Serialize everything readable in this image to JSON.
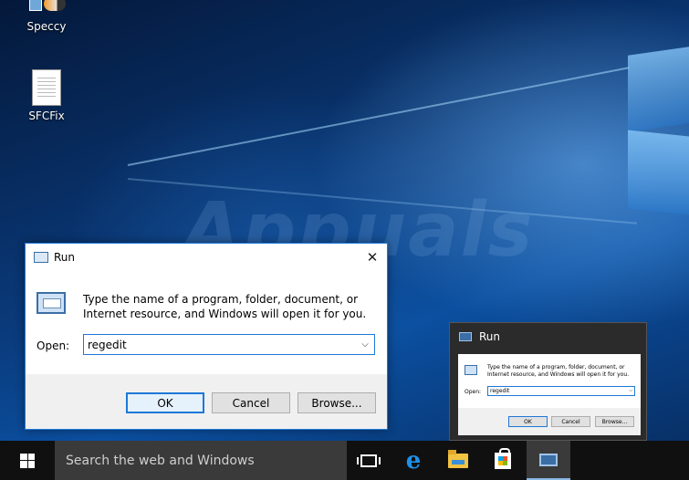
{
  "desktop": {
    "icons": [
      {
        "label": "Speccy"
      },
      {
        "label": "SFCFix"
      }
    ]
  },
  "run_dialog": {
    "title": "Run",
    "close_glyph": "✕",
    "description": "Type the name of a program, folder, document, or Internet resource, and Windows will open it for you.",
    "open_label": "Open:",
    "open_value": "regedit",
    "dropdown_glyph": "⌵",
    "ok_label": "OK",
    "cancel_label": "Cancel",
    "browse_label": "Browse..."
  },
  "thumbnail": {
    "title": "Run",
    "description": "Type the name of a program, folder, document, or Internet resource, and Windows will open it for you.",
    "open_label": "Open:",
    "open_value": "regedit",
    "ok_label": "OK",
    "cancel_label": "Cancel",
    "browse_label": "Browse..."
  },
  "taskbar": {
    "search_placeholder": "Search the web and Windows",
    "edge_glyph": "e",
    "icons": [
      "windows-logo-icon",
      "task-view-icon",
      "edge-icon",
      "file-explorer-icon",
      "store-icon",
      "run-icon"
    ]
  },
  "colors": {
    "accent": "#1e78d7",
    "taskbar": "#101010",
    "search_box": "#3a3a3a"
  }
}
